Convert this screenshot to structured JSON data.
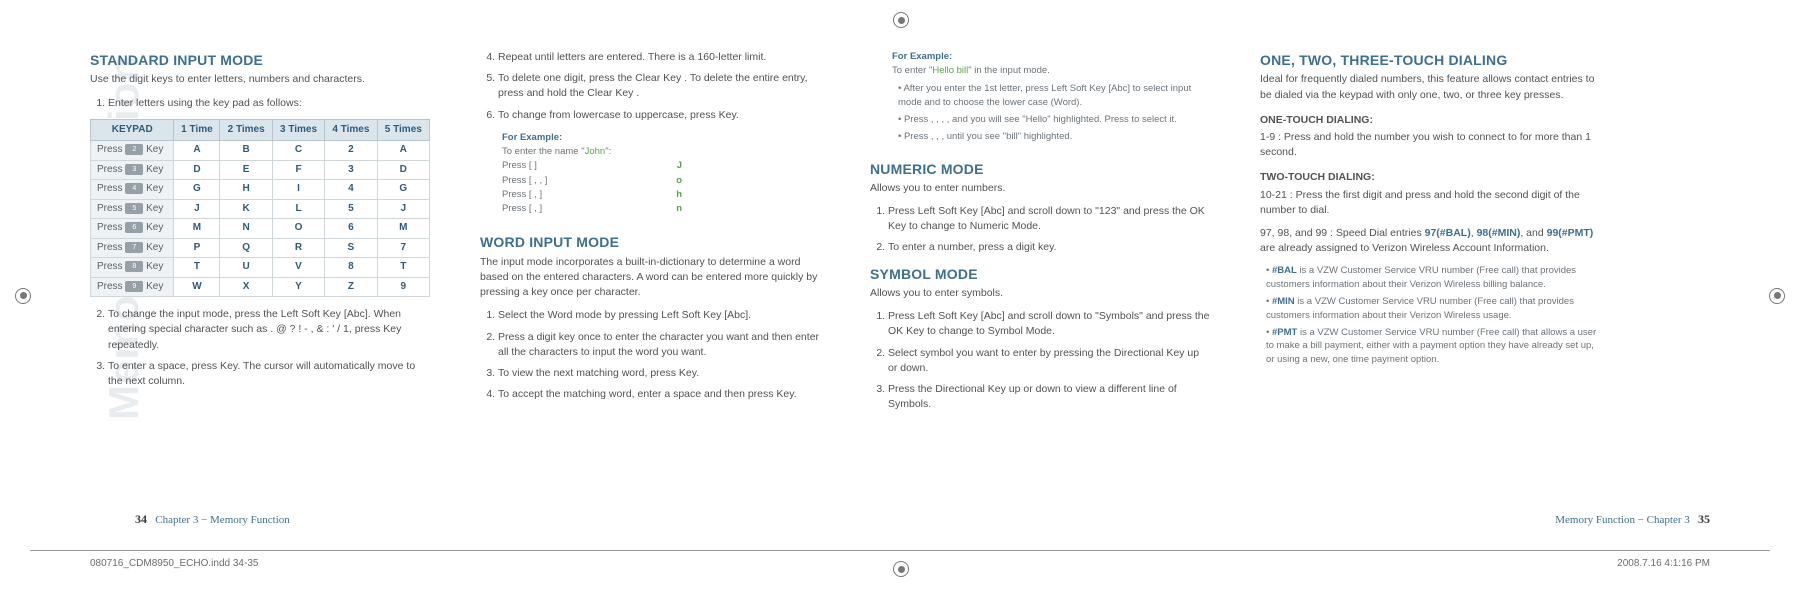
{
  "side_text": "Memory Function",
  "page_left_num": "34",
  "page_left_label": "Chapter 3 − Memory Function",
  "page_right_label": "Memory Function − Chapter 3",
  "page_right_num": "35",
  "print_left": "080716_CDM8950_ECHO.indd   34-35",
  "print_right": "2008.7.16   4:1:16 PM",
  "col1": {
    "h1": "STANDARD INPUT MODE",
    "h1_sub": "Use the digit keys to enter letters, numbers and characters.",
    "step1": "Enter letters using the key pad as follows:",
    "table_headers": [
      "KEYPAD",
      "1 Time",
      "2 Times",
      "3 Times",
      "4 Times",
      "5 Times"
    ],
    "rows": [
      {
        "label": "Press",
        "key": "2",
        "cells": [
          "A",
          "B",
          "C",
          "2",
          "A"
        ]
      },
      {
        "label": "Press",
        "key": "3",
        "cells": [
          "D",
          "E",
          "F",
          "3",
          "D"
        ]
      },
      {
        "label": "Press",
        "key": "4",
        "cells": [
          "G",
          "H",
          "I",
          "4",
          "G"
        ]
      },
      {
        "label": "Press",
        "key": "5",
        "cells": [
          "J",
          "K",
          "L",
          "5",
          "J"
        ]
      },
      {
        "label": "Press",
        "key": "6",
        "cells": [
          "M",
          "N",
          "O",
          "6",
          "M"
        ]
      },
      {
        "label": "Press",
        "key": "7",
        "cells": [
          "P",
          "Q",
          "R",
          "S",
          "7"
        ]
      },
      {
        "label": "Press",
        "key": "8",
        "cells": [
          "T",
          "U",
          "V",
          "8",
          "T"
        ]
      },
      {
        "label": "Press",
        "key": "9",
        "cells": [
          "W",
          "X",
          "Y",
          "Z",
          "9"
        ]
      }
    ],
    "step2": "To change the input mode, press the Left Soft Key [Abc]. When entering special character such as . @ ? ! - , & : ' / 1, press Key repeatedly.",
    "step3": "To enter a space, press Key. The cursor will automatically move to the next column."
  },
  "col2": {
    "step4": "Repeat until letters are entered. There is a 160-letter limit.",
    "step5": "To delete one digit, press the Clear Key . To delete the entire entry, press and hold the Clear Key .",
    "step6": "To change from lowercase to uppercase, press Key.",
    "ex_title": "For Example:",
    "ex_sub": "To enter the name \"John\":",
    "ex_lines": [
      {
        "l": "Press [ ]",
        "r": "J"
      },
      {
        "l": "Press [ , , ]",
        "r": "o"
      },
      {
        "l": "Press [ , ]",
        "r": "h"
      },
      {
        "l": "Press [ , ]",
        "r": "n"
      }
    ],
    "h2": "WORD INPUT MODE",
    "h2_sub": "The input mode incorporates a built-in-dictionary to determine a word based on the entered characters. A word can be entered more quickly by pressing a key once per character.",
    "w1": "Select the Word mode by pressing Left Soft Key [Abc].",
    "w2": "Press a digit key once to enter the character you want and then enter all the characters to input the word you want.",
    "w3": "To view the next matching word, press Key.",
    "w4": "To accept the matching word, enter a space and then press Key."
  },
  "col3": {
    "ex_title": "For Example:",
    "ex_sub": "To enter \"Hello bill\" in the input mode.",
    "ex_b1": "After you enter the 1st letter, press Left Soft Key [Abc] to select input mode and to choose the lower case (Word).",
    "ex_b2": "Press , , , , and you will see \"Hello\" highlighted. Press to select it.",
    "ex_b3": "Press , , , until you see \"bill\" highlighted.",
    "h_num": "NUMERIC MODE",
    "num_sub": "Allows you to enter numbers.",
    "n1": "Press Left Soft Key [Abc] and scroll down to \"123\" and press the OK Key to change to Numeric Mode.",
    "n2": "To enter a number, press a digit key.",
    "h_sym": "SYMBOL MODE",
    "sym_sub": "Allows you to enter symbols.",
    "s1": "Press Left Soft Key [Abc] and scroll down to \"Symbols\" and press the OK Key to change to Symbol Mode.",
    "s2": "Select symbol you want to enter by pressing the Directional Key up or down.",
    "s3": "Press the Directional Key up or down to view a different line of Symbols."
  },
  "col4": {
    "h": "ONE, TWO, THREE-TOUCH DIALING",
    "sub": "Ideal for frequently dialed numbers, this feature allows contact entries to be dialed via the keypad with only one, two, or three key presses.",
    "h1": "ONE-TOUCH DIALING:",
    "l1": "1-9 : Press and hold the number you wish to connect to for more than 1 second.",
    "h2": "TWO-TOUCH DIALING:",
    "l2": "10-21 : Press the first digit and press and hold the second digit of the number to dial.",
    "l3_pre": "97, 98, and 99 : Speed Dial entries ",
    "l3_a": "97(#BAL)",
    "l3_sep1": ", ",
    "l3_b": "98(#MIN)",
    "l3_sep2": ", and ",
    "l3_c": "99(#PMT)",
    "l3_post": " are already assigned to Verizon Wireless Account Information.",
    "f1_tag": "#BAL",
    "f1": " is a VZW Customer Service VRU number (Free call) that provides customers information about their Verizon Wireless billing balance.",
    "f2_tag": "#MIN",
    "f2": " is a VZW Customer Service VRU number (Free call) that provides customers information about their Verizon Wireless usage.",
    "f3_tag": "#PMT",
    "f3": " is a VZW Customer Service VRU number (Free call) that allows a user to make a bill payment, either with a payment option they have already set up, or using a new, one time payment option."
  }
}
